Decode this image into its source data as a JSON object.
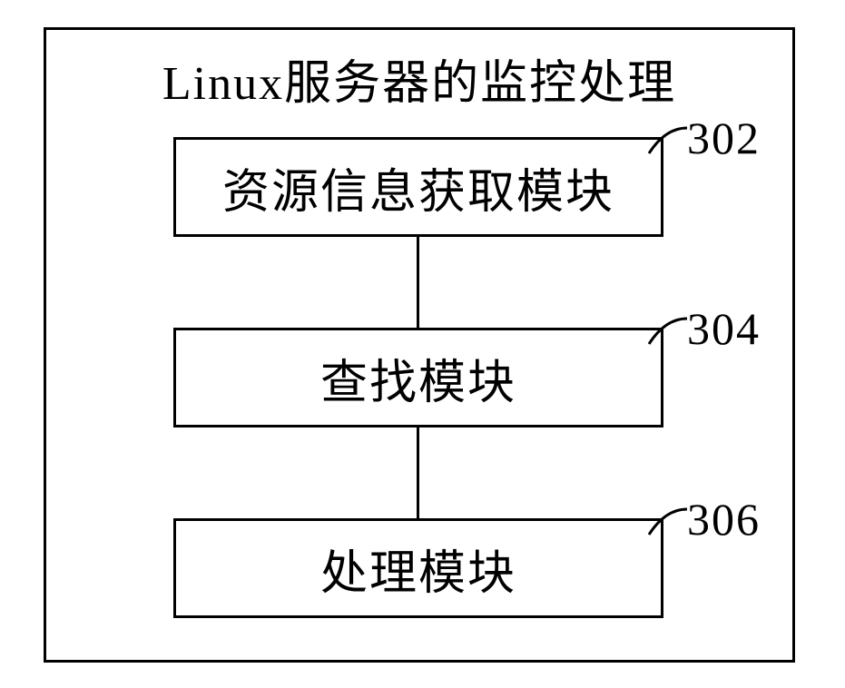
{
  "diagram": {
    "title": "Linux服务器的监控处理",
    "blocks": [
      {
        "label": "资源信息获取模块",
        "ref": "302"
      },
      {
        "label": "查找模块",
        "ref": "304"
      },
      {
        "label": "处理模块",
        "ref": "306"
      }
    ]
  }
}
